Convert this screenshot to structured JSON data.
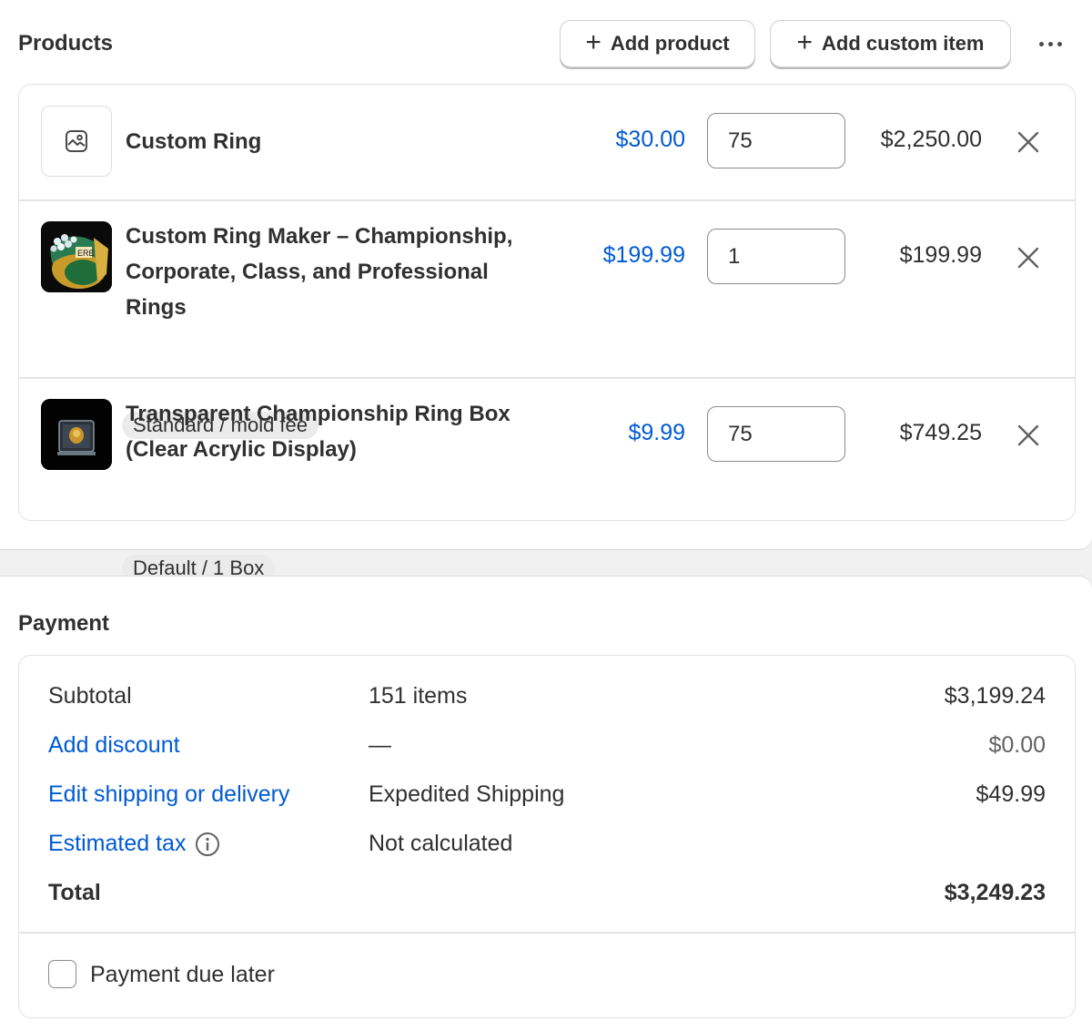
{
  "products": {
    "title": "Products",
    "add_product_label": "Add product",
    "add_custom_item_label": "Add custom item",
    "items": [
      {
        "name_lines": [
          "Custom Ring"
        ],
        "variant": "",
        "price": "$30.00",
        "quantity": "75",
        "total": "$2,250.00",
        "image": "placeholder-image-icon"
      },
      {
        "name_lines": [
          "Custom Ring Maker – Championship,",
          "Corporate, Class, and Professional",
          "Rings"
        ],
        "variant": "Standard / mold fee",
        "price": "$199.99",
        "quantity": "1",
        "total": "$199.99",
        "image": "championship-ring-photo"
      },
      {
        "name_lines": [
          "Transparent Championship Ring Box",
          "(Clear Acrylic Display)"
        ],
        "variant": "Default / 1 Box",
        "price": "$9.99",
        "quantity": "75",
        "total": "$749.25",
        "image": "ring-box-photo"
      }
    ]
  },
  "payment": {
    "title": "Payment",
    "subtotal": {
      "label": "Subtotal",
      "detail": "151 items",
      "amount": "$3,199.24"
    },
    "discount": {
      "label": "Add discount",
      "detail": "—",
      "amount": "$0.00"
    },
    "shipping": {
      "label": "Edit shipping or delivery",
      "detail": "Expedited Shipping",
      "amount": "$49.99"
    },
    "tax": {
      "label": "Estimated tax",
      "detail": "Not calculated"
    },
    "total": {
      "label": "Total",
      "amount": "$3,249.23"
    },
    "payment_due_later_label": "Payment due later",
    "payment_due_later_checked": false
  },
  "colors": {
    "link": "#005bd3",
    "text": "#303030",
    "border": "#e1e1e1"
  }
}
